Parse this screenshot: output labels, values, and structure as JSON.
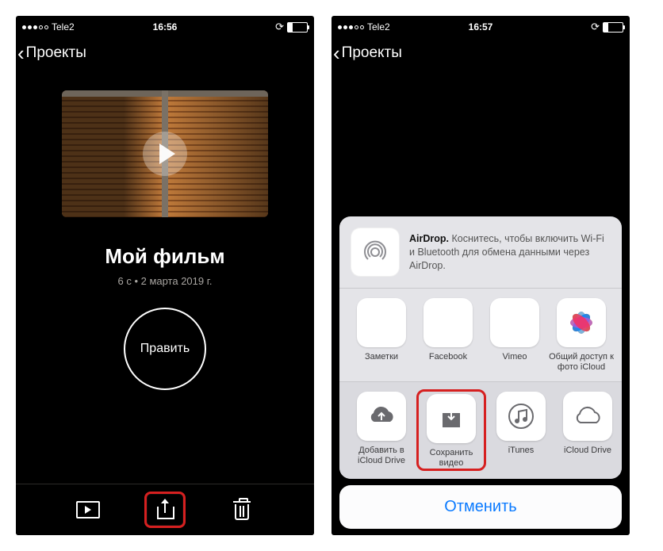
{
  "left": {
    "status": {
      "carrier": "Tele2",
      "time": "16:56"
    },
    "nav": {
      "back": "Проекты"
    },
    "project": {
      "title": "Мой фильм",
      "subtitle": "6 с • 2 марта 2019 г.",
      "edit": "Править"
    }
  },
  "right": {
    "status": {
      "carrier": "Tele2",
      "time": "16:57"
    },
    "nav": {
      "back": "Проекты"
    },
    "airdrop": {
      "title": "AirDrop.",
      "desc": "Коснитесь, чтобы включить Wi-Fi и Bluetooth для обмена данными через AirDrop."
    },
    "apps": [
      {
        "label": "Заметки"
      },
      {
        "label": "Facebook"
      },
      {
        "label": "Vimeo"
      },
      {
        "label": "Общий доступ к фото iCloud"
      }
    ],
    "actions": [
      {
        "label": "Добавить в iCloud Drive"
      },
      {
        "label": "Сохранить видео"
      },
      {
        "label": "iTunes"
      },
      {
        "label": "iCloud Drive"
      }
    ],
    "cancel": "Отменить"
  }
}
